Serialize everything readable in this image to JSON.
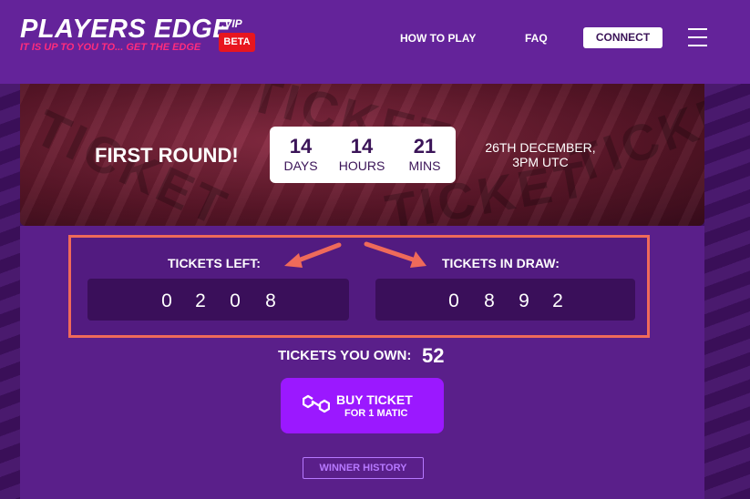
{
  "header": {
    "logo_title": "PLAYERS EDGE",
    "logo_suffix": ".VIP",
    "tagline_start": "IT IS UP TO YOU TO...",
    "tagline_em": "GET THE EDGE",
    "badge": "BETA",
    "nav": {
      "how_to_play": "HOW TO PLAY",
      "faq": "FAQ",
      "connect": "CONNECT"
    }
  },
  "round": {
    "title": "FIRST ROUND!",
    "countdown": [
      {
        "value": "14",
        "label": "DAYS"
      },
      {
        "value": "14",
        "label": "HOURS"
      },
      {
        "value": "21",
        "label": "MINS"
      }
    ],
    "date_line1": "26TH DECEMBER,",
    "date_line2": "3PM UTC"
  },
  "tickets": {
    "left_label": "TICKETS LEFT:",
    "left_digits": [
      "0",
      "2",
      "0",
      "8"
    ],
    "draw_label": "TICKETS IN DRAW:",
    "draw_digits": [
      "0",
      "8",
      "9",
      "2"
    ],
    "own_label": "TICKETS YOU OWN:",
    "own_count": "52"
  },
  "buy": {
    "title": "BUY TICKET",
    "subtitle": "FOR 1 MATIC"
  },
  "winner_history": "WINNER HISTORY",
  "colors": {
    "header_bg": "#64239a",
    "panel_bg": "#5a1f8a",
    "digit_box_bg": "#3a0f5a",
    "accent_pink": "#ff2c7c",
    "beta_red": "#e8161f",
    "buy_purple": "#9b18ff",
    "highlight_border": "#ef6a5a"
  }
}
